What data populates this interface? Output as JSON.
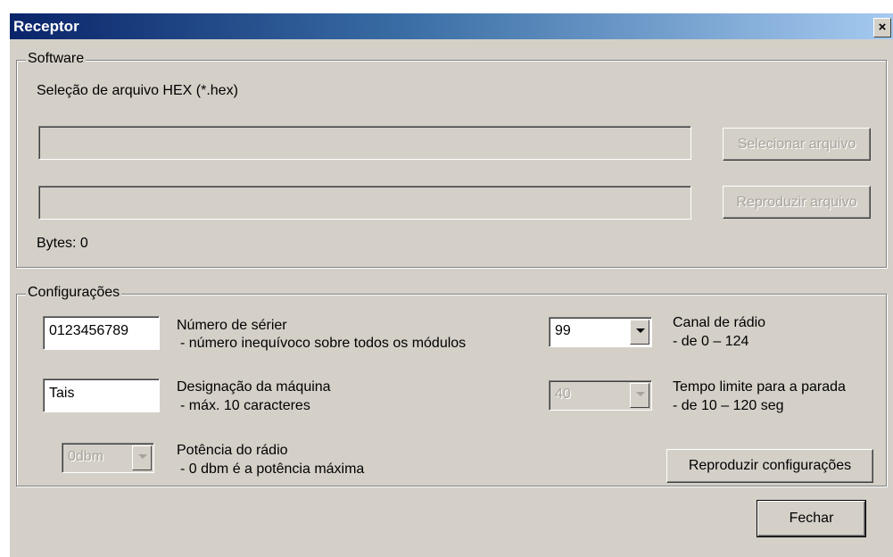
{
  "window": {
    "title": "Receptor",
    "close_icon": "close-icon",
    "close_glyph": "×"
  },
  "software": {
    "legend": "Software",
    "file_label": "Seleção de arquivo HEX (*.hex)",
    "file_path_value": "",
    "progress_value": "",
    "select_button": "Selecionar arquivo",
    "play_button": "Reproduzir arquivo",
    "bytes_label": "Bytes: 0"
  },
  "config": {
    "legend": "Configurações",
    "serial_value": "0123456789",
    "serial_label": "Número de sérier",
    "serial_desc": "- número inequívoco sobre todos os módulos",
    "channel_value": "99",
    "channel_label": "Canal de rádio",
    "channel_desc": "- de 0 – 124",
    "machine_value": "Tais",
    "machine_label": "Designação da máquina",
    "machine_desc": "- máx. 10 caracteres",
    "timeout_value": "40",
    "timeout_label": "Tempo limite para a parada",
    "timeout_desc": "- de 10 – 120 seg",
    "power_value": "0dbm",
    "power_label": "Potência do rádio",
    "power_desc": "- 0 dbm é a potência máxima",
    "apply_button": "Reproduzir configurações"
  },
  "footer": {
    "close_button": "Fechar"
  }
}
